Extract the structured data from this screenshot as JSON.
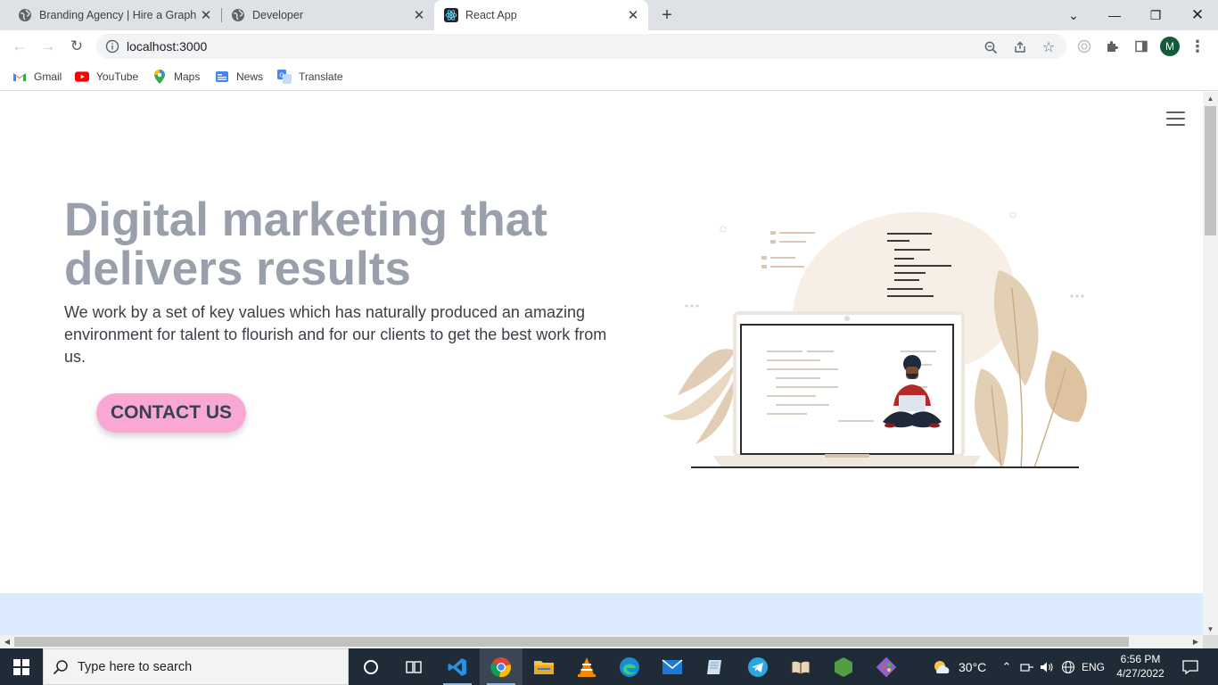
{
  "browser": {
    "tabs": [
      {
        "title": "Branding Agency | Hire a Graphic",
        "icon": "globe-icon",
        "active": false
      },
      {
        "title": "Developer",
        "icon": "globe-icon",
        "active": false
      },
      {
        "title": "React App",
        "icon": "react-icon",
        "active": true
      }
    ],
    "url": "localhost:3000",
    "profile_initial": "M",
    "bookmarks": [
      {
        "label": "Gmail",
        "icon": "gmail-icon"
      },
      {
        "label": "YouTube",
        "icon": "youtube-icon"
      },
      {
        "label": "Maps",
        "icon": "maps-icon"
      },
      {
        "label": "News",
        "icon": "news-icon"
      },
      {
        "label": "Translate",
        "icon": "translate-icon"
      }
    ]
  },
  "page": {
    "hero_title": "Digital marketing that delivers results",
    "hero_subtitle": "We work by a set of key values which has naturally produced an amazing environment for talent to flourish and for our clients to get the best work from us.",
    "cta_label": "CONTACT US",
    "menu_icon": "hamburger-menu-icon",
    "colors": {
      "title": "#9aa0ab",
      "cta_background": "#f9a8d4",
      "footer_band": "#dbeafe"
    }
  },
  "taskbar": {
    "search_placeholder": "Type here to search",
    "weather": "30°C",
    "language": "ENG",
    "time": "6:56 PM",
    "date": "4/27/2022",
    "apps": [
      "cortana-icon",
      "task-view-icon",
      "vscode-icon",
      "chrome-icon",
      "file-explorer-icon",
      "vlc-icon",
      "edge-icon",
      "mail-icon",
      "notepad-icon",
      "telegram-icon",
      "reader-icon",
      "nodejs-icon",
      "git-icon"
    ]
  }
}
